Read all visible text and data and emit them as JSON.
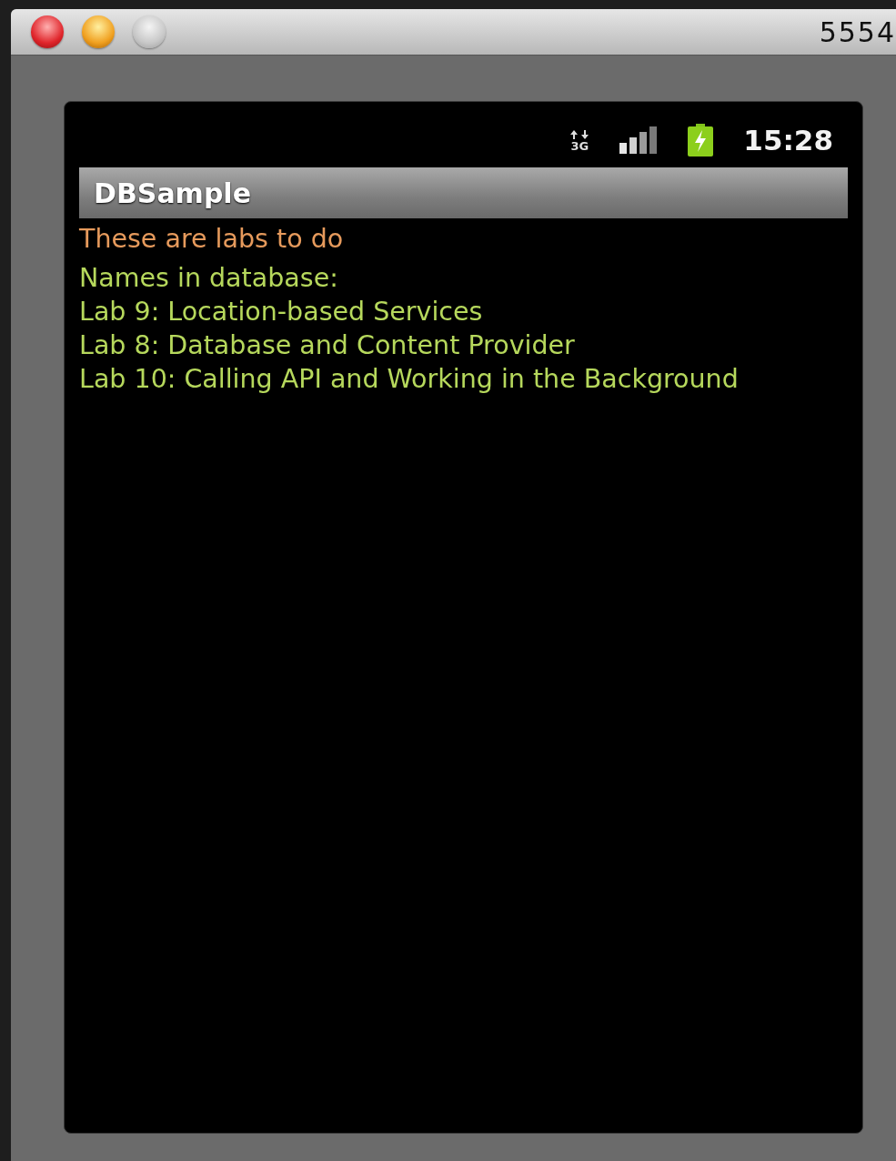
{
  "window": {
    "title": "5554"
  },
  "status_bar": {
    "network_type": "3G",
    "time": "15:28"
  },
  "app_bar": {
    "title": "DBSample"
  },
  "content": {
    "heading": "These are labs to do",
    "list_label": "Names in database:",
    "items": [
      "Lab 9: Location-based Services",
      "Lab 8: Database and Content Provider",
      "Lab 10: Calling API and Working in the Background"
    ]
  }
}
